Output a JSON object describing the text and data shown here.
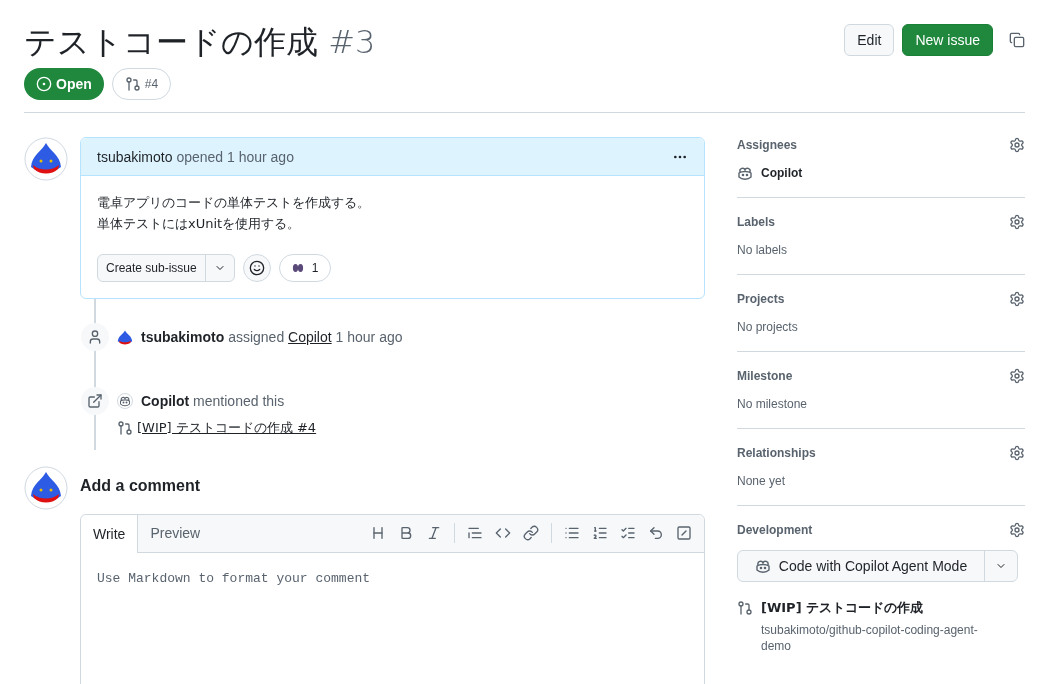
{
  "header": {
    "title": "テストコードの作成",
    "number": "#3",
    "state": "Open",
    "linked_pr": "#4",
    "buttons": [
      {
        "kind": "secondary",
        "label": "Edit"
      },
      {
        "kind": "primary",
        "label": "New issue"
      }
    ]
  },
  "issue": {
    "author": "tsubakimoto",
    "action": "opened",
    "time": "1 hour ago",
    "body": [
      "電卓アプリのコードの単体テストを作成する。",
      "単体テストにはxUnitを使用する。"
    ],
    "sub_issue_button": "Create sub-issue",
    "reaction_count": "1"
  },
  "timeline": [
    {
      "kind": "assigned",
      "actor": "tsubakimoto",
      "action": "assigned",
      "target": "Copilot",
      "time": "1 hour ago"
    },
    {
      "kind": "mentioned",
      "actor": "Copilot",
      "action": "mentioned this",
      "reference": "[WIP] テストコードの作成 #4"
    }
  ],
  "comment_form": {
    "heading": "Add a comment",
    "tabs": [
      {
        "label": "Write",
        "selected": true
      },
      {
        "label": "Preview",
        "selected": false
      }
    ],
    "placeholder": "Use Markdown to format your comment"
  },
  "sidebar": [
    {
      "title": "Assignees",
      "kind": "assignee",
      "value": "Copilot"
    },
    {
      "title": "Labels",
      "kind": "empty",
      "value": "No labels"
    },
    {
      "title": "Projects",
      "kind": "empty",
      "value": "No projects"
    },
    {
      "title": "Milestone",
      "kind": "empty",
      "value": "No milestone"
    },
    {
      "title": "Relationships",
      "kind": "empty",
      "value": "None yet"
    },
    {
      "title": "Development",
      "kind": "development",
      "button": "Code with Copilot Agent Mode",
      "pr_title": "[WIP] テストコードの作成",
      "repo": "tsubakimoto/github-copilot-coding-agent-demo"
    }
  ]
}
